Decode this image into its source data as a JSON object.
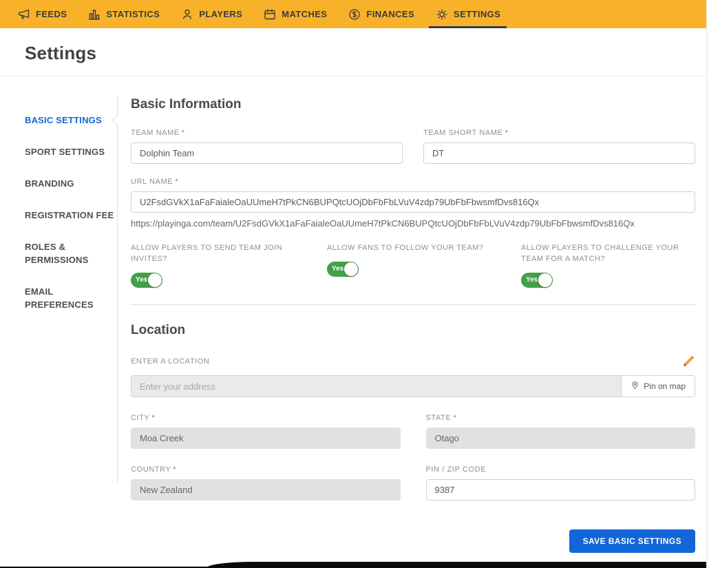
{
  "nav": {
    "items": [
      {
        "label": "FEEDS",
        "icon": "megaphone-icon"
      },
      {
        "label": "STATISTICS",
        "icon": "bar-chart-icon"
      },
      {
        "label": "PLAYERS",
        "icon": "player-icon"
      },
      {
        "label": "MATCHES",
        "icon": "calendar-icon"
      },
      {
        "label": "FINANCES",
        "icon": "coin-icon"
      },
      {
        "label": "SETTINGS",
        "icon": "gear-icon"
      }
    ],
    "active": "SETTINGS"
  },
  "page": {
    "title": "Settings"
  },
  "sidebar": {
    "items": [
      {
        "label": "BASIC SETTINGS"
      },
      {
        "label": "SPORT SETTINGS"
      },
      {
        "label": "BRANDING"
      },
      {
        "label": "REGISTRATION FEE"
      },
      {
        "label": "ROLES & PERMISSIONS"
      },
      {
        "label": "EMAIL PREFERENCES"
      }
    ],
    "active": "BASIC SETTINGS"
  },
  "basic": {
    "heading": "Basic Information",
    "team_name": {
      "label": "TEAM NAME",
      "required": "*",
      "value": "Dolphin Team"
    },
    "team_short_name": {
      "label": "TEAM SHORT NAME",
      "required": "*",
      "value": "DT"
    },
    "url_name": {
      "label": "URL NAME",
      "required": "*",
      "value": "U2FsdGVkX1aFaFaialeOaUUmeH7tPkCN6BUPQtcUOjDbFbFbLVuV4zdp79UbFbFbwsmfDvs816Qx",
      "helper": "https://playinga.com/team/U2FsdGVkX1aFaFaialeOaUUmeH7tPkCN6BUPQtcUOjDbFbFbLVuV4zdp79UbFbFbwsmfDvs816Qx"
    },
    "toggles": [
      {
        "label": "ALLOW PLAYERS TO SEND TEAM JOIN INVITES?",
        "state": "Yes"
      },
      {
        "label": "ALLOW FANS TO FOLLOW YOUR TEAM?",
        "state": "Yes"
      },
      {
        "label": "ALLOW PLAYERS TO CHALLENGE YOUR TEAM FOR A MATCH?",
        "state": "Yes"
      }
    ]
  },
  "location": {
    "heading": "Location",
    "enter_label": "ENTER A LOCATION",
    "address": {
      "placeholder": "Enter your address",
      "pin_button": "Pin on map"
    },
    "city": {
      "label": "CITY",
      "required": "*",
      "value": "Moa Creek"
    },
    "state": {
      "label": "STATE",
      "required": "*",
      "value": "Otago"
    },
    "country": {
      "label": "COUNTRY",
      "required": "*",
      "value": "New Zealand"
    },
    "zip": {
      "label": "PIN / ZIP CODE",
      "value": "9387"
    }
  },
  "actions": {
    "save_label": "SAVE BASIC SETTINGS"
  },
  "colors": {
    "topbar": "#F7B229",
    "sidebar_active": "#1565D8",
    "toggle_on": "#43A047",
    "save_button": "#1266D8",
    "required": "#E25449"
  }
}
